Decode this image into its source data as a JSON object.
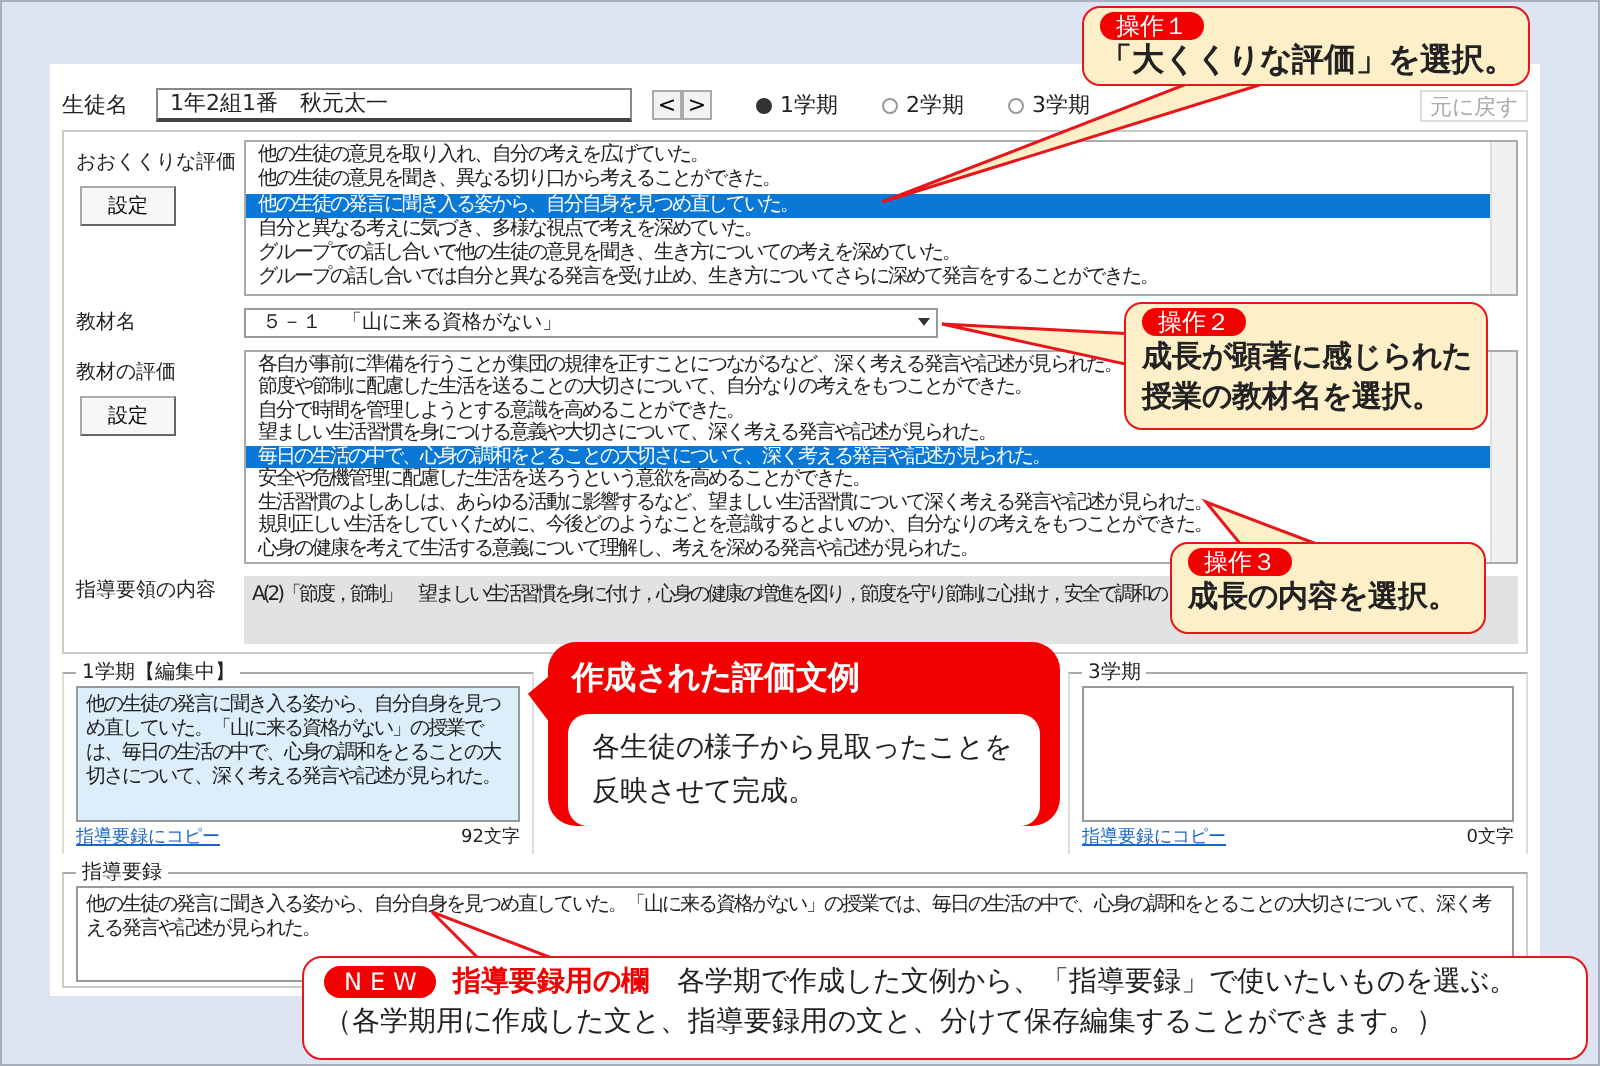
{
  "student": {
    "label": "生徒名",
    "value": "1年2組1番　秋元太一",
    "prev": "<",
    "next": ">"
  },
  "terms": [
    {
      "label": "1学期",
      "selected": true
    },
    {
      "label": "2学期",
      "selected": false
    },
    {
      "label": "3学期",
      "selected": false
    }
  ],
  "undo_button": {
    "label": "元に戻す",
    "disabled": true
  },
  "broad_evaluation": {
    "label": "おおくくりな評価",
    "button": "設定",
    "items": [
      {
        "text": "他の生徒の意見を取り入れ、自分の考えを広げていた。",
        "selected": false
      },
      {
        "text": "他の生徒の意見を聞き、異なる切り口から考えることができた。",
        "selected": false
      },
      {
        "text": "他の生徒の発言に聞き入る姿から、自分自身を見つめ直していた。",
        "selected": true
      },
      {
        "text": "自分と異なる考えに気づき、多様な視点で考えを深めていた。",
        "selected": false
      },
      {
        "text": "グループでの話し合いで他の生徒の意見を聞き、生き方についての考えを深めていた。",
        "selected": false
      },
      {
        "text": "グループの話し合いでは自分と異なる発言を受け止め、生き方についてさらに深めて発言をすることができた。",
        "selected": false
      }
    ]
  },
  "material": {
    "label": "教材名",
    "value": "５－１　「山に来る資格がない」"
  },
  "material_evaluation": {
    "label": "教材の評価",
    "button": "設定",
    "items": [
      {
        "text": "各自が事前に準備を行うことが集団の規律を正すことにつながるなど、深く考える発言や記述が見られた。",
        "selected": false
      },
      {
        "text": "節度や節制に配慮した生活を送ることの大切さについて、自分なりの考えをもつことができた。",
        "selected": false
      },
      {
        "text": "自分で時間を管理しようとする意識を高めることができた。",
        "selected": false
      },
      {
        "text": "望ましい生活習慣を身につける意義や大切さについて、深く考える発言や記述が見られた。",
        "selected": false
      },
      {
        "text": "毎日の生活の中で、心身の調和をとることの大切さについて、深く考える発言や記述が見られた。",
        "selected": true
      },
      {
        "text": "安全や危機管理に配慮した生活を送ろうという意欲を高めることができた。",
        "selected": false
      },
      {
        "text": "生活習慣のよしあしは、あらゆる活動に影響するなど、望ましい生活習慣について深く考える発言や記述が見られた。",
        "selected": false
      },
      {
        "text": "規則正しい生活をしていくために、今後どのようなことを意識するとよいのか、自分なりの考えをもつことができた。",
        "selected": false
      },
      {
        "text": "心身の健康を考えて生活する意義について理解し、考えを深める発言や記述が見られた。",
        "selected": false
      }
    ]
  },
  "guideline": {
    "label": "指導要領の内容",
    "text": "A(2)「節度，節制」　望ましい生活習慣を身に付け，心身の健康の増進を図り，節度を守り節制に心掛け，安全で調和の"
  },
  "term_panels": [
    {
      "title": "1学期【編集中】",
      "text": "他の生徒の発言に聞き入る姿から、自分自身を見つめ直していた。「山に来る資格がない」の授業では、毎日の生活の中で、心身の調和をとることの大切さについて、深く考える発言や記述が見られた。",
      "link": "指導要録にコピー",
      "count": "92文字"
    },
    {
      "title": "3学期",
      "link": "指導要録にコピー",
      "count": "0文字"
    }
  ],
  "record": {
    "title": "指導要録",
    "text": "他の生徒の発言に聞き入る姿から、自分自身を見つめ直していた。「山に来る資格がない」の授業では、毎日の生活の中で、心身の調和をとることの大切さについて、深く考える発言や記述が見られた。"
  },
  "callouts": [
    {
      "kind": "note",
      "badge": "操作１",
      "text": "「大くくりな評価」を選択。"
    },
    {
      "kind": "note",
      "badge": "操作２",
      "text": "成長が顕著に感じられた授業の教材名を選択。"
    },
    {
      "kind": "note",
      "badge": "操作３",
      "text": "成長の内容を選択。"
    },
    {
      "kind": "banner",
      "title": "作成された評価文例",
      "text": "各生徒の様子から見取ったことを反映させて完成。"
    },
    {
      "kind": "wide",
      "badge": "NEW",
      "heading": "指導要録用の欄",
      "text": "各学期で作成した文例から、「指導要録」で使いたいものを選ぶ。",
      "note": "（各学期用に作成した文と、指導要録用の文と、分けて保存編集することができます。）"
    }
  ]
}
